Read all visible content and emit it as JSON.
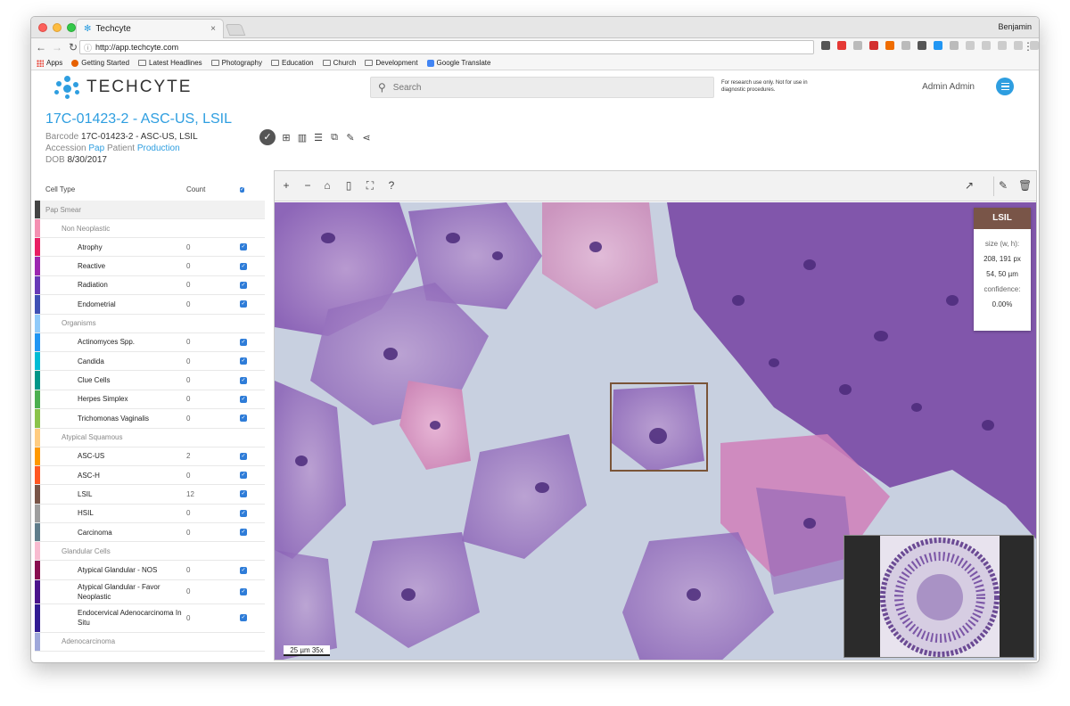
{
  "browser": {
    "tab_title": "Techcyte",
    "tab_close": "×",
    "profile_name": "Benjamin",
    "url": "http://app.techcyte.com",
    "bookmarks": [
      "Apps",
      "Getting Started",
      "Latest Headlines",
      "Photography",
      "Education",
      "Church",
      "Development",
      "Google Translate"
    ],
    "menu_glyph": "⋮"
  },
  "app": {
    "logo_text": "TECHCYTE",
    "search_placeholder": "Search",
    "disclaimer": "For research use only. Not for use in diagnostic procedures.",
    "user_name": "Admin Admin",
    "accent_color": "#2e9ee0"
  },
  "case": {
    "title": "17C-01423-2 - ASC-US, LSIL",
    "barcode_label": "Barcode",
    "barcode_value": "17C-01423-2 - ASC-US, LSIL",
    "accession_label": "Accession",
    "accession_value": "Pap",
    "patient_label": "Patient",
    "patient_value": "Production",
    "dob_label": "DOB",
    "dob_value": "8/30/2017"
  },
  "cell_table": {
    "headers": {
      "type": "Cell Type",
      "count": "Count"
    },
    "section": "Pap Smear",
    "rows": [
      {
        "kind": "group",
        "label": "Non Neoplastic",
        "color": "#f48fb1"
      },
      {
        "kind": "item",
        "label": "Atrophy",
        "count": "0",
        "color": "#e91e63"
      },
      {
        "kind": "item",
        "label": "Reactive",
        "count": "0",
        "color": "#9c27b0"
      },
      {
        "kind": "item",
        "label": "Radiation",
        "count": "0",
        "color": "#673ab7"
      },
      {
        "kind": "item",
        "label": "Endometrial",
        "count": "0",
        "color": "#3f51b5"
      },
      {
        "kind": "group",
        "label": "Organisms",
        "color": "#90caf9"
      },
      {
        "kind": "item",
        "label": "Actinomyces Spp.",
        "count": "0",
        "color": "#2196f3"
      },
      {
        "kind": "item",
        "label": "Candida",
        "count": "0",
        "color": "#00bcd4"
      },
      {
        "kind": "item",
        "label": "Clue Cells",
        "count": "0",
        "color": "#009688"
      },
      {
        "kind": "item",
        "label": "Herpes Simplex",
        "count": "0",
        "color": "#4caf50"
      },
      {
        "kind": "item",
        "label": "Trichomonas Vaginalis",
        "count": "0",
        "color": "#8bc34a"
      },
      {
        "kind": "group",
        "label": "Atypical Squamous",
        "color": "#ffcc80"
      },
      {
        "kind": "item",
        "label": "ASC-US",
        "count": "2",
        "color": "#ff9800"
      },
      {
        "kind": "item",
        "label": "ASC-H",
        "count": "0",
        "color": "#ff5722"
      },
      {
        "kind": "item",
        "label": "LSIL",
        "count": "12",
        "color": "#795548"
      },
      {
        "kind": "item",
        "label": "HSIL",
        "count": "0",
        "color": "#9e9e9e"
      },
      {
        "kind": "item",
        "label": "Carcinoma",
        "count": "0",
        "color": "#607d8b"
      },
      {
        "kind": "group",
        "label": "Glandular Cells",
        "color": "#f8bbd0"
      },
      {
        "kind": "item",
        "label": "Atypical Glandular - NOS",
        "count": "0",
        "color": "#880e4f"
      },
      {
        "kind": "item2",
        "label": "Atypical Glandular - Favor Neoplastic",
        "count": "0",
        "color": "#4a148c"
      },
      {
        "kind": "item3",
        "label": "Endocervical Adenocarcinoma In Situ",
        "count": "0",
        "color": "#311b92"
      },
      {
        "kind": "group",
        "label": "Adenocarcinoma",
        "color": "#9fa8da"
      }
    ]
  },
  "viewer": {
    "help_glyph": "?",
    "annotation": {
      "label": "LSIL",
      "size_label": "size (w, h):",
      "size_px": "208, 191 px",
      "size_um": "54, 50 µm",
      "confidence_label": "confidence:",
      "confidence_value": "0.00%",
      "color": "#795548"
    },
    "scale_label": "25 µm 35x"
  }
}
